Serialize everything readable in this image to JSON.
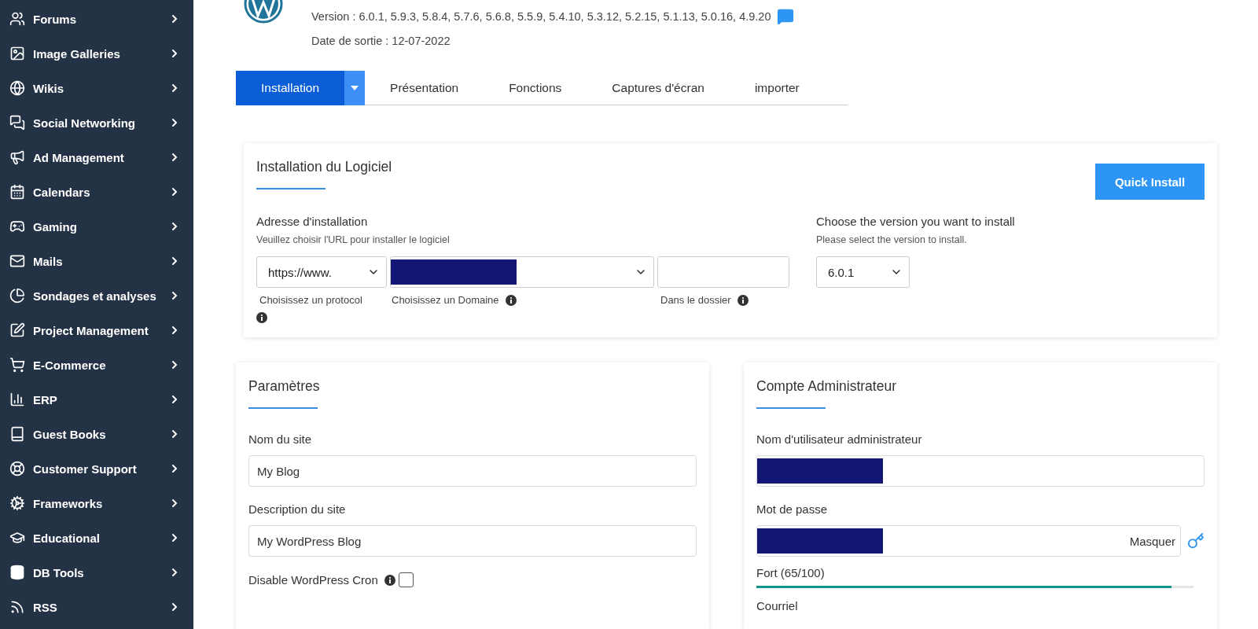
{
  "sidebar": {
    "items": [
      {
        "label": "Forums"
      },
      {
        "label": "Image Galleries"
      },
      {
        "label": "Wikis"
      },
      {
        "label": "Social Networking"
      },
      {
        "label": "Ad Management"
      },
      {
        "label": "Calendars"
      },
      {
        "label": "Gaming"
      },
      {
        "label": "Mails"
      },
      {
        "label": "Sondages et analyses"
      },
      {
        "label": "Project Management"
      },
      {
        "label": "E-Commerce"
      },
      {
        "label": "ERP"
      },
      {
        "label": "Guest Books"
      },
      {
        "label": "Customer Support"
      },
      {
        "label": "Frameworks"
      },
      {
        "label": "Educational"
      },
      {
        "label": "DB Tools"
      },
      {
        "label": "RSS"
      }
    ]
  },
  "header": {
    "version": "Version : 6.0.1, 5.9.3, 5.8.4, 5.7.6, 5.6.8, 5.5.9, 5.4.10, 5.3.12, 5.2.15, 5.1.13, 5.0.16, 4.9.20",
    "release": "Date de sortie : 12-07-2022"
  },
  "tabs": [
    {
      "label": "Installation",
      "selected": true
    },
    {
      "label": "Présentation",
      "selected": false
    },
    {
      "label": "Fonctions",
      "selected": false
    },
    {
      "label": "Captures d'écran",
      "selected": false
    },
    {
      "label": "importer",
      "selected": false
    }
  ],
  "install": {
    "title": "Installation du Logiciel",
    "button": "Quick Install",
    "address_label": "Adresse d'installation",
    "address_hint": "Veuillez choisir l'URL pour installer le logiciel",
    "protocol": "https://www.",
    "protocol_caption": "Choisissez un protocol",
    "domain_caption": "Choisissez un Domaine",
    "folder_caption": "Dans le dossier",
    "version_label": "Choose the version you want to install",
    "version_hint": "Please select the version to install.",
    "version": "6.0.1"
  },
  "settings": {
    "title": "Paramètres",
    "fields": [
      {
        "label": "Nom du site",
        "value": "My Blog"
      },
      {
        "label": "Description du site",
        "value": "My WordPress Blog"
      }
    ],
    "cron_label": "Disable WordPress Cron",
    "cron_checked": false
  },
  "admin": {
    "title": "Compte Administrateur",
    "username_label": "Nom d'utilisateur administrateur",
    "password_label": "Mot de passe",
    "hide": "Masquer",
    "strength": "Fort (65/100)",
    "level": 0.95,
    "email_label": "Courriel"
  }
}
